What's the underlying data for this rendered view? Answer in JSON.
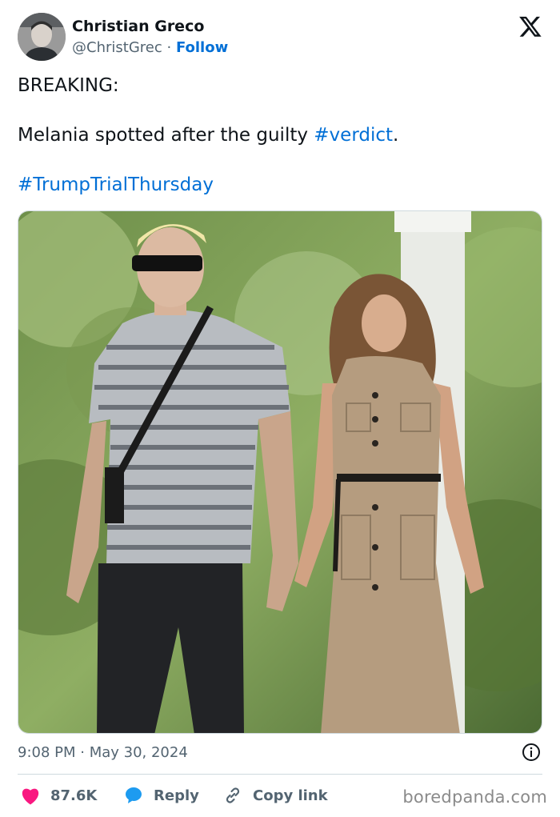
{
  "author": {
    "name": "Christian Greco",
    "handle": "@ChristGrec",
    "separator": "·",
    "follow_label": "Follow"
  },
  "tweet": {
    "line1": "BREAKING:",
    "line2_text": "Melania spotted after the guilty ",
    "line2_hashtag": "#verdict",
    "line2_end": ".",
    "line3_hashtag": "#TrumpTrialThursday"
  },
  "timestamp": "9:08 PM · May 30, 2024",
  "actions": {
    "likes": "87.6K",
    "reply_label": "Reply",
    "copy_label": "Copy link"
  },
  "watermark": "boredpanda.com",
  "colors": {
    "link": "#006fd6",
    "heart": "#f91880",
    "muted": "#536471"
  },
  "icons": {
    "brand": "x-logo-icon",
    "like": "heart-icon",
    "reply": "speech-bubble-icon",
    "copy": "link-icon",
    "info": "info-icon"
  }
}
